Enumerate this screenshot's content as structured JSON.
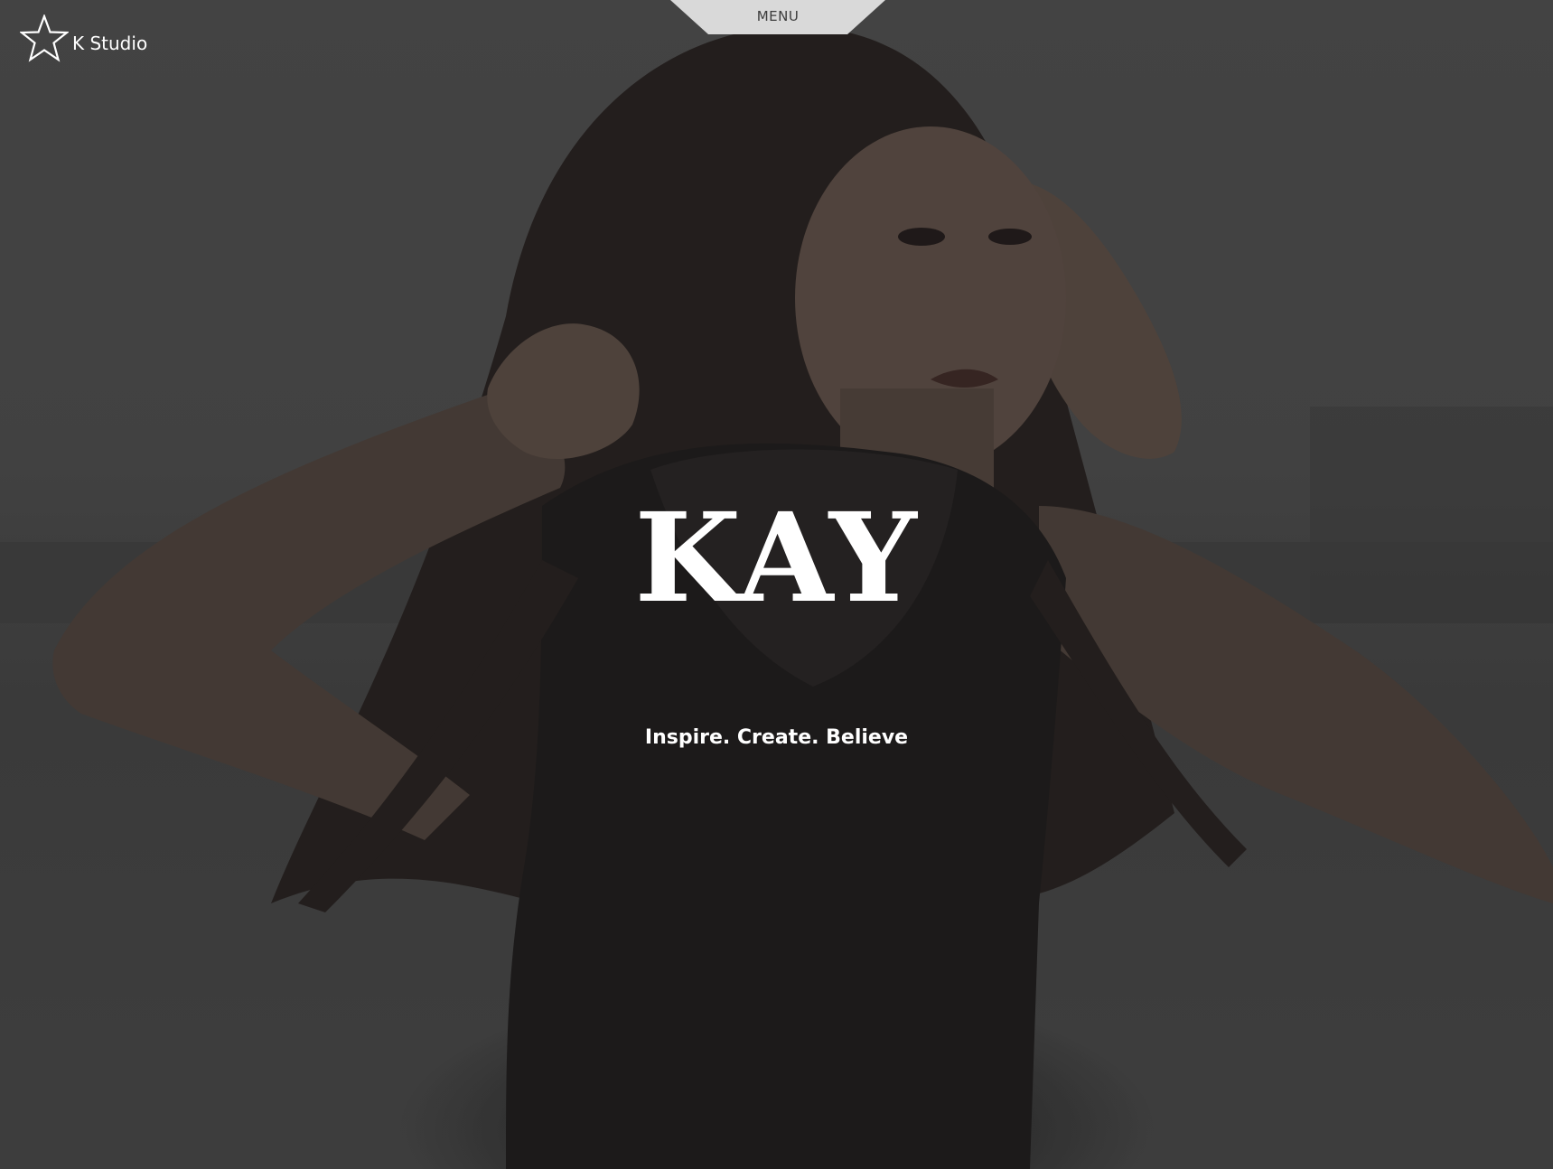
{
  "brand": {
    "name": "K Studio",
    "logo_icon": "star-outline-icon"
  },
  "nav": {
    "menu_label": "MENU"
  },
  "hero": {
    "title": "KAY",
    "tagline": "Inspire. Create. Believe",
    "image_subject": "portrait photograph background"
  },
  "colors": {
    "text": "#ffffff",
    "menu_tab": "#d9d9d9",
    "menu_text": "#3c3c3c",
    "overlay": "#2b2b2b"
  }
}
